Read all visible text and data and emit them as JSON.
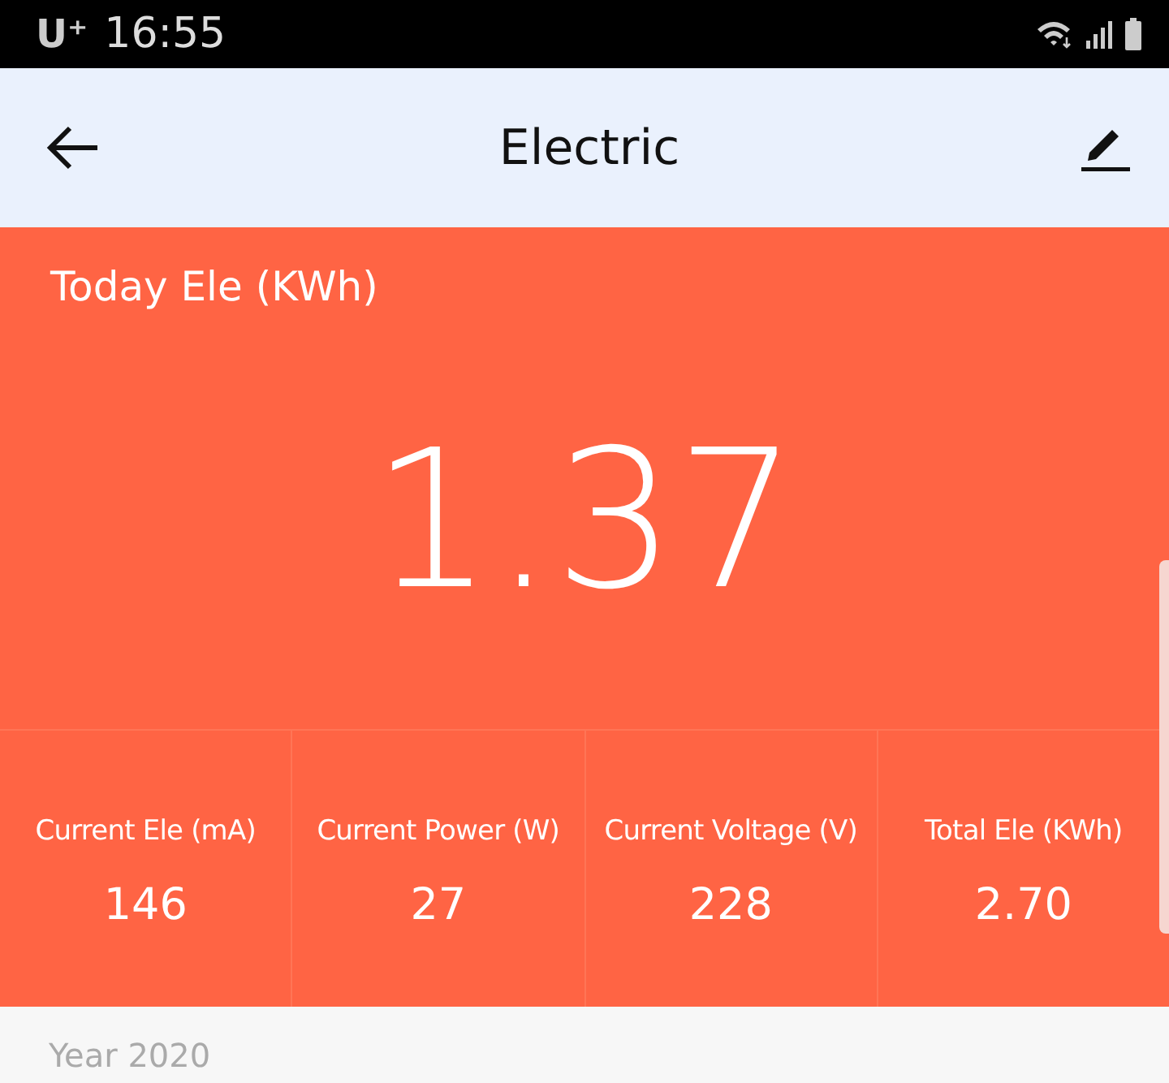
{
  "status_bar": {
    "carrier": "U⁺",
    "time": "16:55"
  },
  "header": {
    "title": "Electric"
  },
  "today": {
    "label": "Today Ele (KWh)",
    "value": "1.37"
  },
  "stats": [
    {
      "label": "Current Ele (mA)",
      "value": "146"
    },
    {
      "label": "Current Power (W)",
      "value": "27"
    },
    {
      "label": "Current Voltage (V)",
      "value": "228"
    },
    {
      "label": "Total Ele (KWh)",
      "value": "2.70"
    }
  ],
  "section": {
    "title": "Year 2020"
  }
}
